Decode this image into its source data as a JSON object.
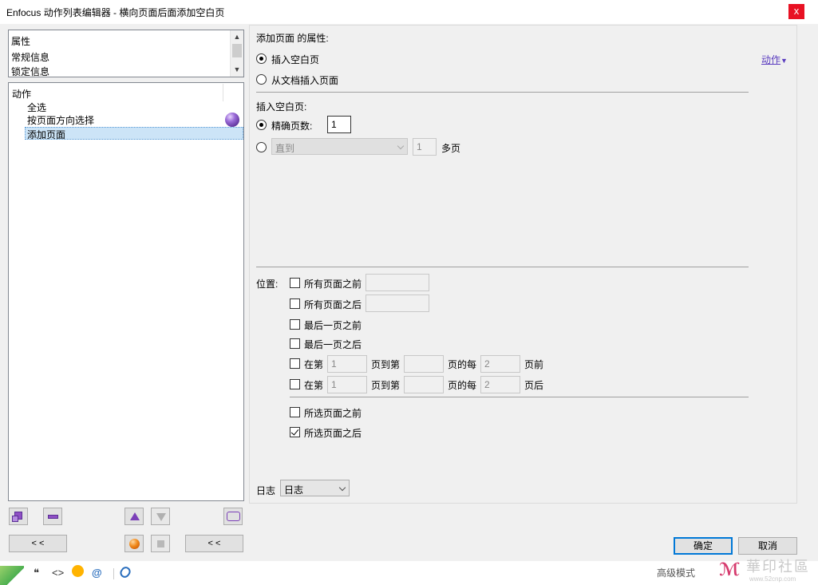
{
  "window": {
    "title": "Enfocus 动作列表编辑器 - 横向页面后面添加空白页",
    "close_glyph": "x"
  },
  "properties_list": {
    "items": [
      "属性",
      "常规信息",
      "锁定信息"
    ]
  },
  "actions_list": {
    "header": "动作",
    "items": [
      "全选",
      "按页面方向选择",
      "添加页面"
    ]
  },
  "left_toolbar": {
    "collapse_left_label": "< <",
    "collapse_right_label": "< <"
  },
  "panel": {
    "header": "添加页面 的属性:",
    "actions_menu_label": "动作",
    "insert_mode": {
      "options": [
        "插入空白页",
        "从文档插入页面"
      ],
      "selected": "插入空白页"
    },
    "insert_blank_label": "插入空白页:",
    "exact_pages_label": "精确页数:",
    "exact_pages_value": "1",
    "until_combo_value": "直到",
    "until_value": "1",
    "multi_pages_label": "多页",
    "position_label": "位置:",
    "positions": {
      "before_all": "所有页面之前",
      "after_all": "所有页面之后",
      "before_last": "最后一页之前",
      "after_last": "最后一页之后",
      "at_label": "在第",
      "to_label": "页到第",
      "every_label": "页的每",
      "range1_from": "1",
      "range1_every": "2",
      "range1_suffix": "页前",
      "range2_from": "1",
      "range2_every": "2",
      "range2_suffix": "页后",
      "before_selected": "所选页面之前",
      "after_selected": "所选页面之后"
    },
    "checked": "所选页面之后",
    "log_label": "日志",
    "log_value": "日志"
  },
  "dialog_buttons": {
    "ok": "确定",
    "cancel": "取消"
  },
  "background_strip": {
    "advanced_mode": "高级模式",
    "quote_glyph": "❝",
    "code_glyph": "<>",
    "at_glyph": "@"
  },
  "watermark": {
    "text": "華印社區",
    "url": "www.52cnp.com"
  },
  "colors": {
    "accent": "#0078d7",
    "close": "#e81123",
    "selection": "#cce4f7",
    "link": "#5a3cbf"
  }
}
